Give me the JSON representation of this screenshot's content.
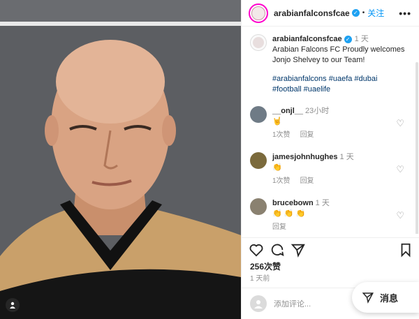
{
  "post": {
    "username": "arabianfalconsfcae",
    "follow_label": "关注",
    "more_label": "•••",
    "caption_time": "1 天",
    "caption_text": "Arabian Falcons FC Proudly welcomes Jonjo Shelvey to our Team!",
    "hashtags_line1": "#arabianfalcons #uaefa #dubai",
    "hashtags_line2": "#football #uaelife"
  },
  "comments": [
    {
      "user": "__onjl__",
      "time": "23小时",
      "text": "🤘",
      "likes": "1次赞",
      "reply": "回复",
      "avatar_color": "#6f7b86"
    },
    {
      "user": "jamesjohnhughes",
      "time": "1 天",
      "text": "👏",
      "likes": "1次赞",
      "reply": "回复",
      "avatar_color": "#7b6a3c"
    },
    {
      "user": "brucebown",
      "time": "1 天",
      "text": "👏 👏 👏",
      "likes": "",
      "reply": "回复",
      "avatar_color": "#8a8170"
    }
  ],
  "footer": {
    "likes_count": "256次赞",
    "posted_ago": "1 天前",
    "add_comment_placeholder": "添加评论..."
  },
  "messages": {
    "label": "消息"
  },
  "colors": {
    "accent": "#0095f6",
    "jersey": "#c9a06a"
  }
}
